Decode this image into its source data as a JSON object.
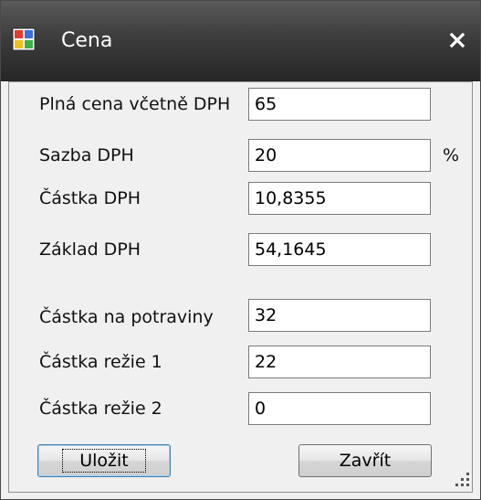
{
  "window": {
    "title": "Cena",
    "close_symbol": "x",
    "app_icon": "form-window-icon",
    "close_icon": "close-icon"
  },
  "fields": [
    {
      "label": "Plná cena včetně DPH",
      "value": "65",
      "unit": ""
    },
    {
      "label": "Sazba DPH",
      "value": "20",
      "unit": "%"
    },
    {
      "label": "Částka DPH",
      "value": "10,8355",
      "unit": ""
    },
    {
      "label": "Základ DPH",
      "value": "54,1645",
      "unit": ""
    },
    {
      "label": "Částka na potraviny",
      "value": "32",
      "unit": ""
    },
    {
      "label": "Částka režie 1",
      "value": "22",
      "unit": ""
    },
    {
      "label": "Částka režie 2",
      "value": "0",
      "unit": ""
    }
  ],
  "buttons": {
    "save_label": "Uložit",
    "close_label": "Zavřít"
  },
  "colors": {
    "titlebar": "#3d3d3d",
    "client_bg": "#f0f0f0",
    "field_border": "#7a7a7a"
  }
}
